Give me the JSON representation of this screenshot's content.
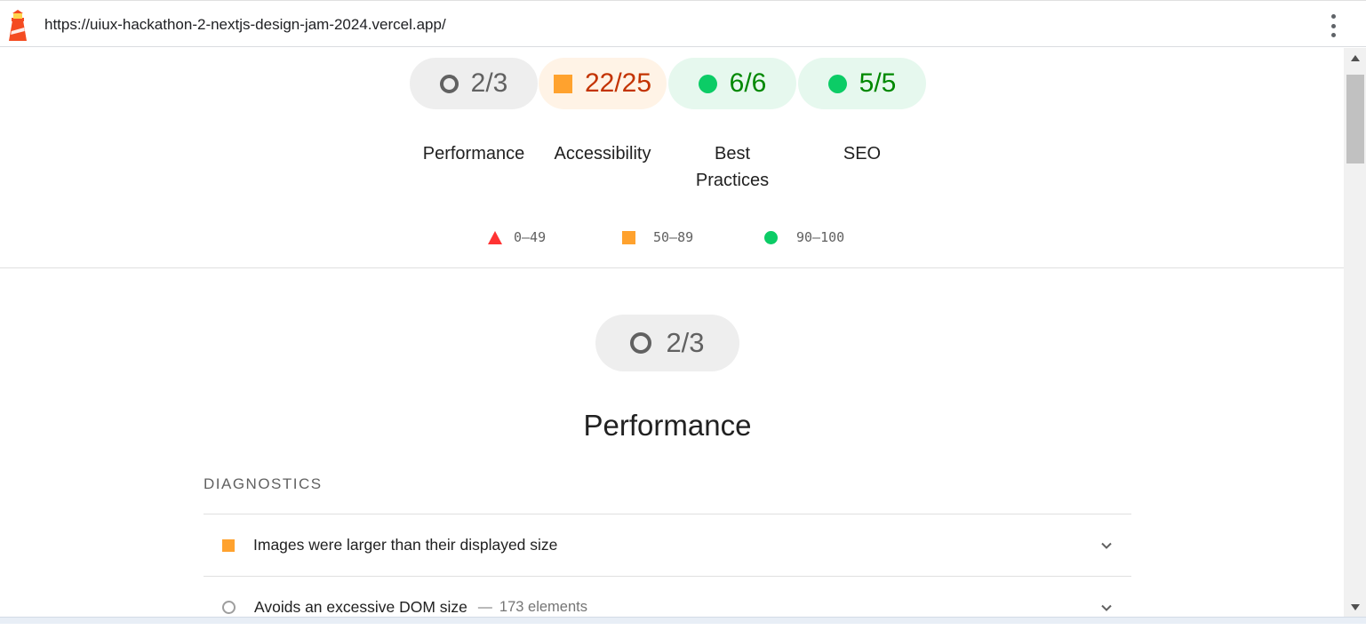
{
  "toolbar": {
    "url": "https://uiux-hackathon-2-nextjs-design-jam-2024.vercel.app/",
    "logo_icon": "lighthouse-icon",
    "menu_icon": "more-vert-icon"
  },
  "gauges": [
    {
      "id": "performance",
      "score": "2/3",
      "label": "Performance",
      "rating": "informative",
      "icon": "circle-outline-icon",
      "color": "#616161"
    },
    {
      "id": "accessibility",
      "score": "22/25",
      "label": "Accessibility",
      "rating": "average",
      "icon": "square-icon",
      "color": "#ffa22e"
    },
    {
      "id": "best-practices",
      "score": "6/6",
      "label_line1": "Best",
      "label_line2": "Practices",
      "rating": "pass",
      "icon": "dot-icon",
      "color": "#0ccc66"
    },
    {
      "id": "seo",
      "score": "5/5",
      "label": "SEO",
      "rating": "pass",
      "icon": "dot-icon",
      "color": "#0ccc66"
    }
  ],
  "legend": [
    {
      "range": "0–49",
      "icon": "triangle-icon",
      "color": "#ff3333"
    },
    {
      "range": "50–89",
      "icon": "square-icon",
      "color": "#ffa22e"
    },
    {
      "range": "90–100",
      "icon": "dot-icon",
      "color": "#0ccc66"
    }
  ],
  "section": {
    "score": "2/3",
    "title": "Performance",
    "diagnostics_heading": "DIAGNOSTICS",
    "audits": [
      {
        "title": "Images were larger than their displayed size",
        "icon": "square-icon",
        "separator": "",
        "detail": ""
      },
      {
        "title": "Avoids an excessive DOM size",
        "icon": "circle-outline-icon",
        "separator": "—",
        "detail": "173 elements"
      }
    ]
  }
}
